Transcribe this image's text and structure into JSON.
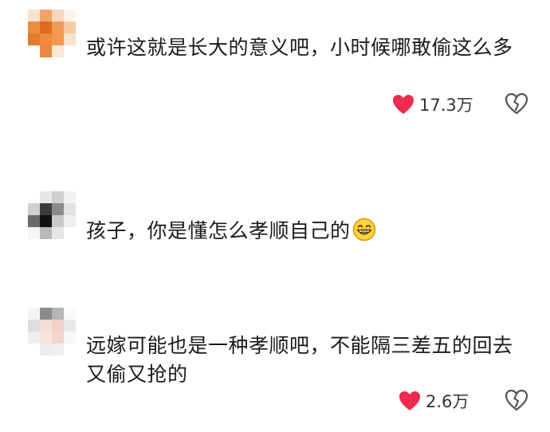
{
  "colors": {
    "heart": "#ee2a4f",
    "text": "#1a1a1a",
    "icon_outline": "#555555"
  },
  "comments": [
    {
      "text": "或许这就是长大的意义吧，小时候哪敢偷这么多",
      "likes": "17.3万",
      "avatar_icon": "pixelated-avatar"
    },
    {
      "text": "孩子，你是懂怎么孝顺自己的",
      "emoji": "grinning-face-icon",
      "avatar_icon": "pixelated-avatar"
    },
    {
      "text": "远嫁可能也是一种孝顺吧，不能隔三差五的回去又偷又抢的",
      "likes": "2.6万",
      "avatar_icon": "pixelated-avatar"
    }
  ]
}
